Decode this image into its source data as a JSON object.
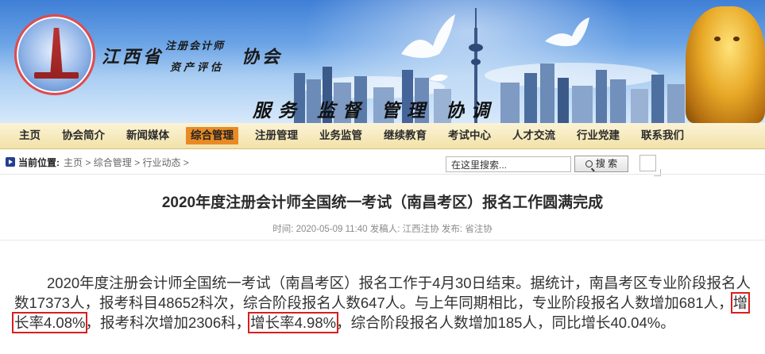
{
  "banner": {
    "assoc_left": "江西省",
    "assoc_sub1": "注册会计师",
    "assoc_sub2": "资产评估",
    "assoc_right": "协会",
    "slogan": "服务 监督 管理 协调"
  },
  "nav": {
    "items": [
      "主页",
      "协会简介",
      "新闻媒体",
      "综合管理",
      "注册管理",
      "业务监管",
      "继续教育",
      "考试中心",
      "人才交流",
      "行业党建",
      "联系我们"
    ],
    "active_index": 3
  },
  "location": {
    "label": "当前位置:",
    "crumbs": [
      "主页",
      "综合管理",
      "行业动态"
    ],
    "sep": ">"
  },
  "search": {
    "placeholder": "在这里搜索...",
    "button_label": "搜 索"
  },
  "article": {
    "title": "2020年度注册会计师全国统一考试（南昌考区）报名工作圆满完成",
    "meta": "时间: 2020-05-09 11:40   发稿人: 江西注协   发布: 省注协",
    "p1": "2020年度注册会计师全国统一考试（南昌考区）报名工作于4月30日结束。据统计，南昌考区专业阶段报名人数17373人，报考科目48652科次，综合阶段报名人数647人。与上年同期相比，专业阶段报名人数增加681人，",
    "hl1": "增长率4.08%",
    "p2": "，报考科次增加2306科，",
    "hl2": "增长率4.98%",
    "p3": "，综合阶段报名人数增加185人，同比增长40.04%。"
  },
  "colors": {
    "nav_active": "#e98a24",
    "highlight": "#d91e1e"
  }
}
